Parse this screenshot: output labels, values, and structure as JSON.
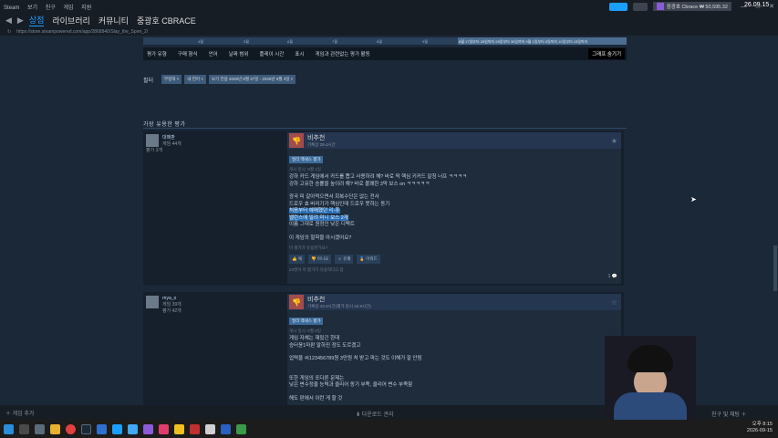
{
  "topbar": {
    "menu": [
      "Steam",
      "보기",
      "친구",
      "게임",
      "지원"
    ],
    "account": "중광호 Cbrace ₩ 50,595.32",
    "clock": "26.09.15"
  },
  "nav": {
    "tabs": [
      "상점",
      "라이브러리",
      "커뮤니티",
      "중광호 CBRACE"
    ],
    "url": "https://store.steampowered.com/app/2868840/Slay_the_Spire_2/"
  },
  "timeline": {
    "labels": [
      "4월",
      "5월",
      "6월",
      "7월",
      "8월",
      "9월"
    ],
    "highlight": "8월 17일부터 28일까지 28일부터 30일까지 9월 1일부터 5일까지 10일부터 15일까지"
  },
  "filters": {
    "items": [
      "평가 유형",
      "구매 형식",
      "언어",
      "날짜 범위",
      "플레이 시간",
      "표시",
      "게임과 관련없는 평가 활동"
    ],
    "hide_graph": "그래프 숨기기"
  },
  "chips": {
    "label": "필터",
    "items": [
      "부정적 ×",
      "내 언어 ×",
      "보기 전용 2026년 8월 27일 - 2026년 9월 3일 ×"
    ]
  },
  "section_title": "가장 유용한 평가",
  "reviews": [
    {
      "author": "대매판",
      "games": "게임 44개",
      "reviews": "평가 3개",
      "verdict": "비추천",
      "hours": "기록상 29.4시간",
      "badge": "얼리 액세스 평가",
      "posted": "게시 일시: 9월 1일",
      "lines": [
        "강하 카드 게임에서 카드를 뽑고 사용하려 해? 바로 딱 핵심 키커드 잘칭 너프 ㅋㅋㅋㅋ",
        "강하 고유한 승률을 높이려 해? 바로 볼쾌한 3막 보스 on ㅋㅋㅋㅋㅋ",
        "",
        "광국 피 갈아먹으면서 회복수단은 없는 전사",
        "드로우 효 버리기가 핵심인데 드로우 못하는 동기",
        "처음부터 예매했던 리-휴",
        "밸런스에 밀려 미니 보스 2개",
        "이름 그대로 원정인 낮은 디펙트",
        "",
        "이 게임의 철학을 아시겠어요?"
      ],
      "selected": [
        "처음부터 예매했던 리-휴",
        "밸런스에 밀려 미니 보스 2개"
      ],
      "helpful_q": "이 평가가 유용한가요?",
      "votes": [
        "예",
        "아니요",
        "유쾌",
        "어워드"
      ],
      "found": "23명이 이 평가가 유용하다고 함",
      "comments": "1"
    },
    {
      "author": "rnya_o",
      "games": "게임 39개",
      "reviews": "평가 42개",
      "verdict": "비추천",
      "hours": "기록상 43.4시간(평가 당시 42.8시간)",
      "badge": "얼리 액세스 평가",
      "posted": "게시 일시: 9월 9일",
      "lines": [
        "게임 자체는 재밌긴 한데",
        "승터윤1마판 말하진 정도 도르겠고",
        "",
        "업력을 씨123456789원 3만원 처 받고 파는 것도 이해가 잘 안됨",
        "",
        "",
        "또한 게임의 또다른 문제는",
        "낮은 변수정을 능력과 클리어 동기 부족, 클리어 변수 부족함",
        "",
        "해도 판에서 이런 게 할 것"
      ],
      "selected": []
    }
  ],
  "bottom_bar": {
    "left": "게임 추가",
    "mid": "다운로드 관리",
    "right": "친구 및 채팅"
  },
  "tray": {
    "time": "오후 8:15",
    "date": "2026-09-15"
  }
}
